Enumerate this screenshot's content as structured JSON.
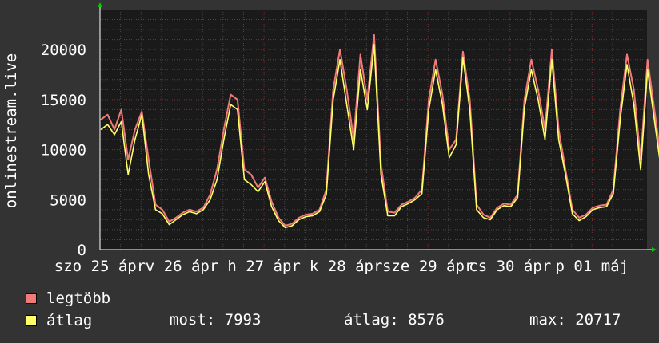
{
  "chart_data": {
    "type": "line",
    "ylabel": "onlinestream.live",
    "ylim": [
      0,
      24000
    ],
    "y_ticks": [
      0,
      5000,
      10000,
      15000,
      20000
    ],
    "y_tick_labels": [
      "0",
      "5000",
      "10000",
      "15000",
      "20000"
    ],
    "x_tick_labels": [
      "szo 25 ápr",
      "v 26 ápr",
      "h 27 ápr",
      "k 28 ápr",
      "sze 29 ápr",
      "cs 30 ápr",
      "p 01 máj"
    ],
    "grid": true,
    "colors": {
      "background": "#333333",
      "plot": "#1a1a1a",
      "grid_minor": "#4a4a4a",
      "grid_major": "#7a3030",
      "axis": "#ffffff",
      "max_series": "#f07a7a",
      "avg_series": "#ffff66",
      "arrow": "#00cc00"
    },
    "days": 6.67,
    "sample_hours": 2,
    "series": [
      {
        "name": "legtöbb",
        "color": "#f07a7a",
        "values": [
          13000,
          13500,
          12000,
          14000,
          9000,
          12000,
          13800,
          9000,
          4500,
          4000,
          2800,
          3200,
          3700,
          4000,
          3800,
          4200,
          5500,
          8000,
          12000,
          15500,
          15000,
          8000,
          7500,
          6200,
          7200,
          4800,
          3200,
          2400,
          2600,
          3200,
          3500,
          3600,
          4000,
          6000,
          16000,
          20000,
          16000,
          11000,
          19500,
          15000,
          21500,
          8500,
          3800,
          3700,
          4500,
          4800,
          5200,
          6000,
          15000,
          19000,
          15500,
          10000,
          11000,
          19800,
          15000,
          4500,
          3500,
          3200,
          4200,
          4600,
          4500,
          5500,
          15000,
          19000,
          16000,
          12000,
          20000,
          12000,
          8000,
          4000,
          3200,
          3500,
          4200,
          4400,
          4500,
          6000,
          14000,
          19500,
          16000,
          9000,
          19000,
          14000,
          9000,
          3800,
          3200,
          3600,
          4400,
          4600,
          4500,
          7000,
          13000,
          16000,
          14000,
          10000,
          9000,
          11500,
          11000,
          4500,
          3100,
          3000,
          3800,
          4100,
          4200,
          5500,
          9000
        ]
      },
      {
        "name": "átlag",
        "color": "#ffff66",
        "values": [
          12000,
          12500,
          11500,
          12800,
          7500,
          11000,
          13500,
          7500,
          4000,
          3600,
          2500,
          3000,
          3500,
          3800,
          3600,
          4000,
          5000,
          7000,
          11000,
          14500,
          14000,
          7000,
          6500,
          5800,
          6800,
          4300,
          2900,
          2200,
          2400,
          3000,
          3300,
          3400,
          3800,
          5500,
          15000,
          19000,
          14500,
          10000,
          18000,
          14000,
          20500,
          7500,
          3400,
          3400,
          4300,
          4600,
          5000,
          5600,
          14000,
          18000,
          14500,
          9200,
          10500,
          19200,
          14000,
          4000,
          3200,
          3000,
          4000,
          4400,
          4300,
          5200,
          14200,
          18000,
          15000,
          11000,
          19000,
          11000,
          7500,
          3600,
          2900,
          3300,
          4000,
          4200,
          4300,
          5600,
          13000,
          18500,
          14500,
          8000,
          18000,
          13000,
          8000,
          3400,
          2900,
          3400,
          4200,
          4400,
          4300,
          6500,
          12500,
          15000,
          13000,
          9200,
          8500,
          11200,
          10500,
          4000,
          2800,
          2800,
          3600,
          3900,
          4000,
          5200,
          7993
        ]
      }
    ]
  },
  "legend": [
    {
      "label": "legtöbb",
      "color": "#f07a7a"
    },
    {
      "label": "átlag",
      "color": "#ffff66"
    }
  ],
  "stats": {
    "now": "most: 7993",
    "avg": "átlag: 8576",
    "max": "max: 20717"
  }
}
